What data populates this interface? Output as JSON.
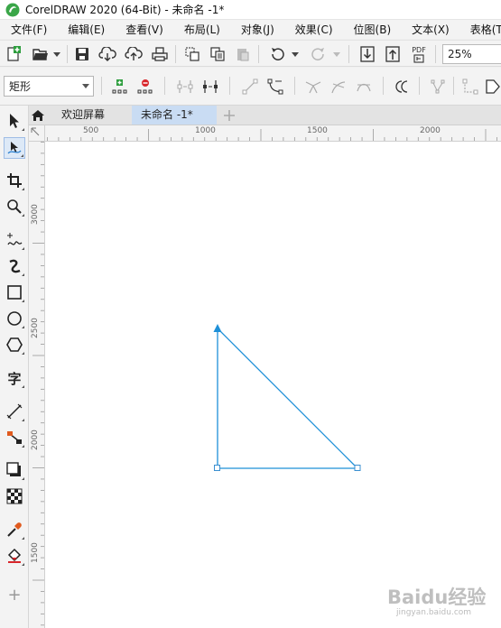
{
  "window": {
    "title": "CorelDRAW 2020 (64-Bit) - 未命名 -1*"
  },
  "menu": [
    "文件(F)",
    "编辑(E)",
    "查看(V)",
    "布局(L)",
    "对象(J)",
    "效果(C)",
    "位图(B)",
    "文本(X)",
    "表格(T)"
  ],
  "toolbar": {
    "pdf_label": "PDF",
    "zoom_value": "25%"
  },
  "property_bar": {
    "shape_select": "矩形"
  },
  "tabs": {
    "welcome": "欢迎屏幕",
    "document": "未命名 -1*"
  },
  "rulers": {
    "horizontal": [
      "500",
      "1000",
      "1500",
      "2000"
    ],
    "vertical": [
      "3000",
      "2500",
      "2000",
      "1500"
    ]
  },
  "toolbox": {
    "text_tool_glyph": "字",
    "add_glyph": "+"
  },
  "canvas": {
    "shape": "triangle",
    "stroke_color": "#1e90d8",
    "handle_color": "#3a8fd0"
  },
  "watermark": {
    "text": "Baidu经验",
    "sub": "jingyan.baidu.com"
  }
}
